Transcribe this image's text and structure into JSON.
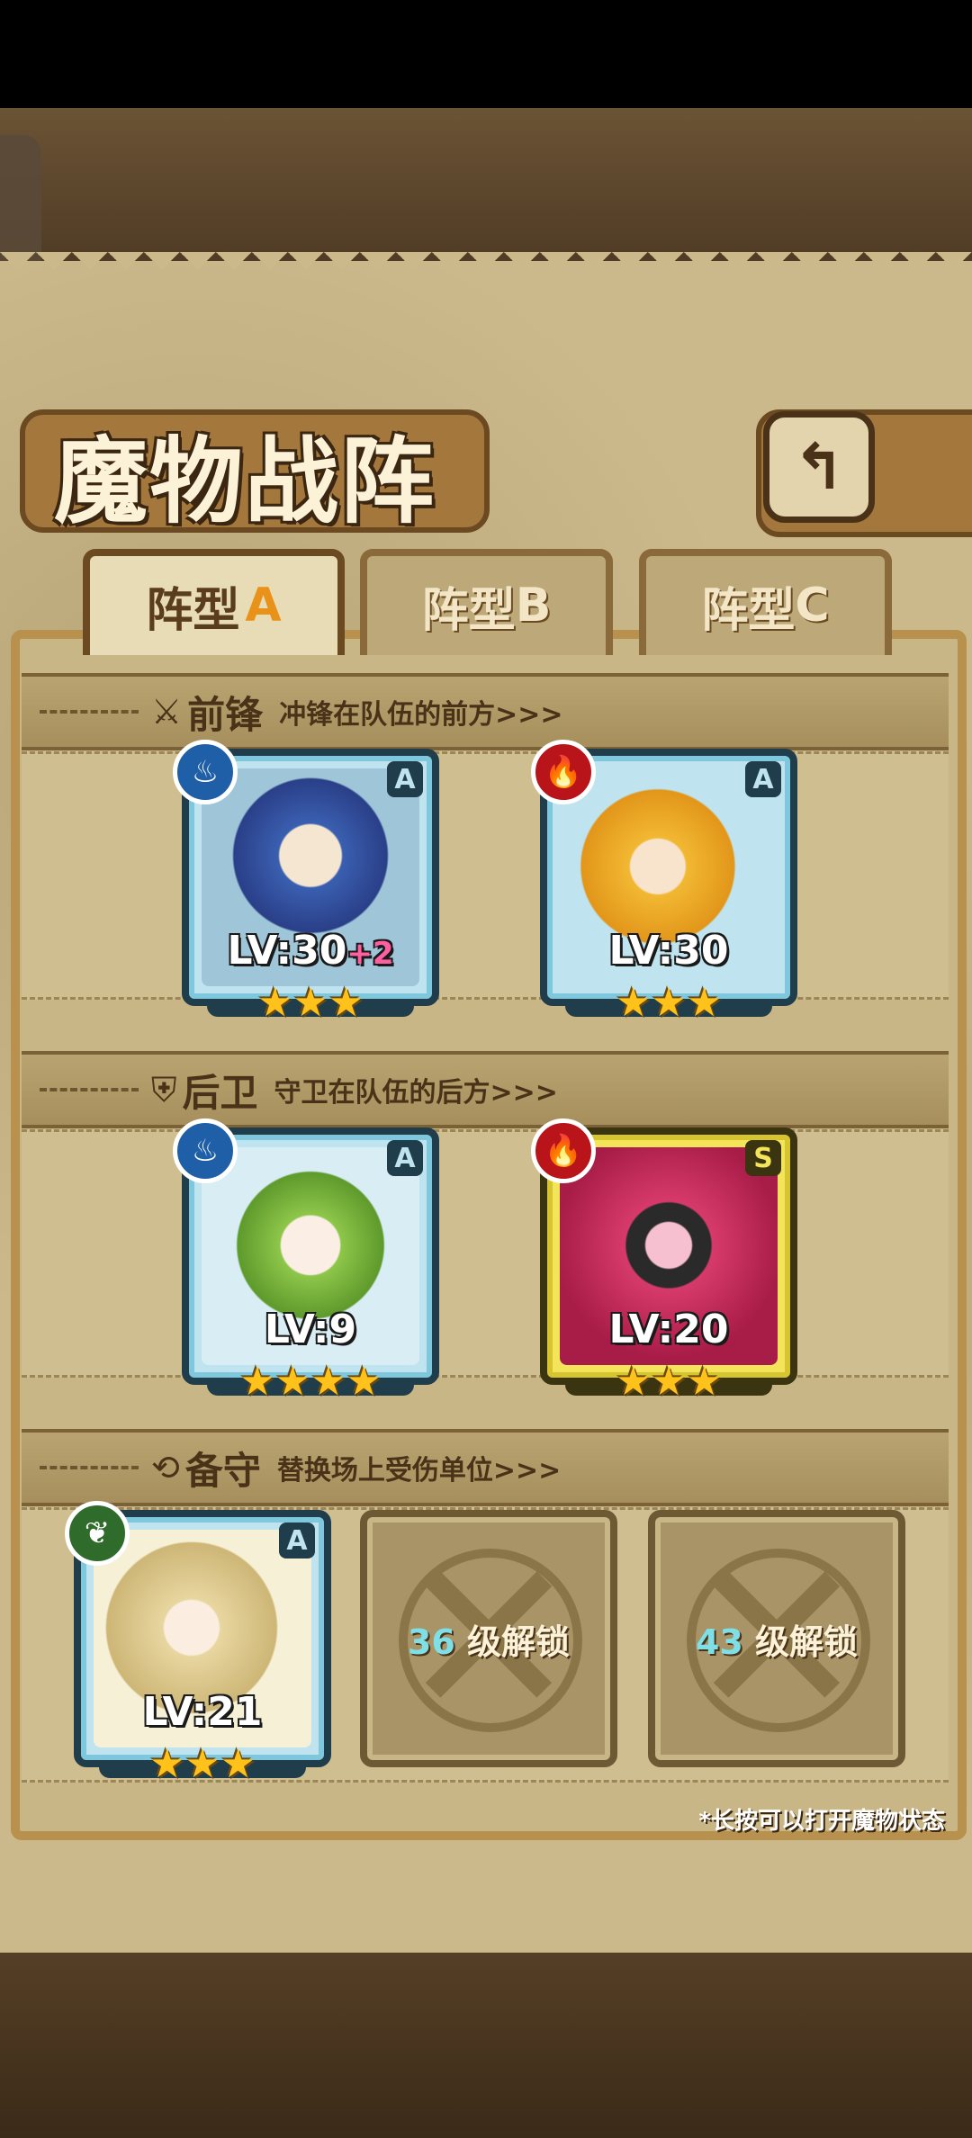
{
  "title": "魔物战阵",
  "back_icon": "back-arrow-icon",
  "tabs": [
    {
      "prefix": "阵型",
      "letter": "A",
      "active": true
    },
    {
      "prefix": "阵型",
      "letter": "B",
      "active": false
    },
    {
      "prefix": "阵型",
      "letter": "C",
      "active": false
    }
  ],
  "sections": {
    "vanguard": {
      "icon": "sword-icon",
      "title": "前锋",
      "desc": "冲锋在队伍的前方>>>"
    },
    "rearguard": {
      "icon": "shield-icon",
      "title": "后卫",
      "desc": "守卫在队伍的后方>>>"
    },
    "reserve": {
      "icon": "swap-icon",
      "title": "备守",
      "desc": "替换场上受伤单位>>>"
    }
  },
  "vanguard_units": [
    {
      "element": "water",
      "rank": "A",
      "lv": "LV:30",
      "bonus": "+2",
      "stars": "★★★",
      "frame": "blue"
    },
    {
      "element": "fire",
      "rank": "A",
      "lv": "LV:30",
      "bonus": "",
      "stars": "★★★",
      "frame": "blue"
    }
  ],
  "rearguard_units": [
    {
      "element": "water",
      "rank": "A",
      "lv": "LV:9",
      "bonus": "",
      "stars": "★★★★",
      "frame": "blue"
    },
    {
      "element": "fire",
      "rank": "S",
      "lv": "LV:20",
      "bonus": "",
      "stars": "★★★",
      "frame": "gold"
    }
  ],
  "reserve_units": [
    {
      "element": "wood",
      "rank": "A",
      "lv": "LV:21",
      "bonus": "",
      "stars": "★★★",
      "frame": "blue"
    }
  ],
  "locked_slots": [
    {
      "level": "36",
      "text": "级解锁"
    },
    {
      "level": "43",
      "text": "级解锁"
    }
  ],
  "hint": "*长按可以打开魔物状态",
  "colors": {
    "water": "#1f5fa8",
    "fire": "#b8141a",
    "wood": "#2f6b2a",
    "parchment": "#cbb98b",
    "accent": "#e8921a"
  }
}
